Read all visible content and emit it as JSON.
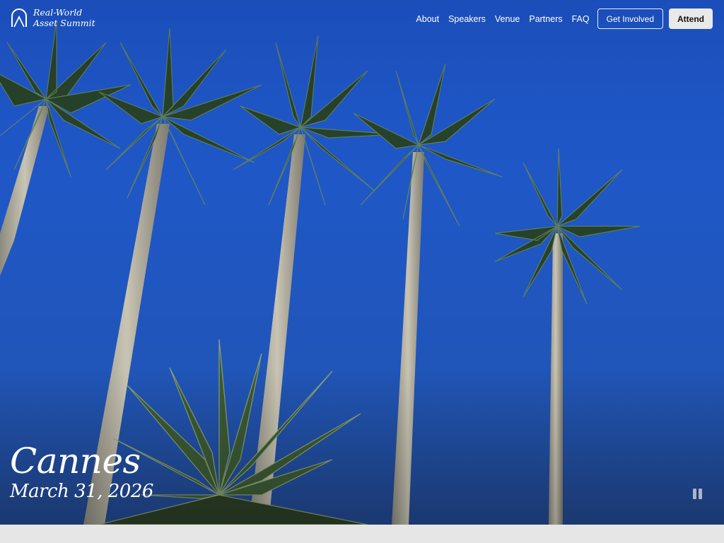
{
  "brand": {
    "line1": "Real-World",
    "line2": "Asset Summit",
    "icon": "arch-logo-icon"
  },
  "nav": {
    "links": [
      "About",
      "Speakers",
      "Venue",
      "Partners",
      "FAQ"
    ],
    "get_involved": "Get Involved",
    "attend": "Attend"
  },
  "hero": {
    "city": "Cannes",
    "date": "March 31, 2026",
    "media_control": "pause-icon"
  },
  "colors": {
    "sky": "#1f57c6",
    "text": "#ffffff",
    "attend_bg": "#e9e9e9",
    "band": "#e6e6e6"
  }
}
